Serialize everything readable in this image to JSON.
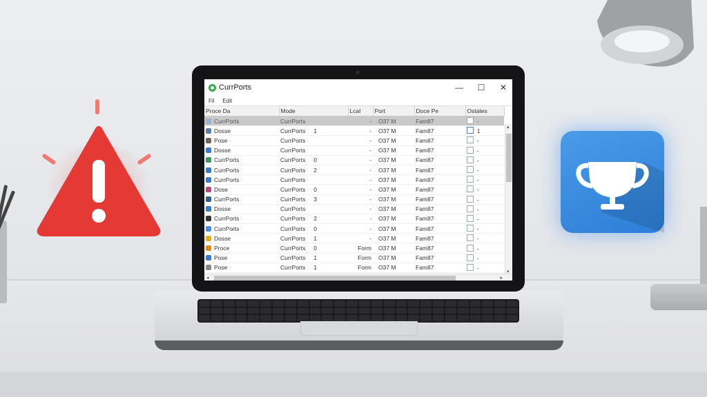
{
  "window": {
    "title": "CurrPorts",
    "minimize": "—",
    "maximize": "☐",
    "close": "✕"
  },
  "menu": [
    "Fil",
    "Edit"
  ],
  "table": {
    "columns": [
      "Proce Da",
      "Mode",
      "Lcal",
      "Port",
      "Doce Pe",
      "Ostates"
    ],
    "rows": [
      {
        "icon": "#9bb3cc",
        "name": "CurrPorts",
        "mode": "CurrPorts",
        "n": "",
        "lcal": "-",
        "port": "O37 M",
        "doce": "Fam87",
        "checked": false,
        "flag": "-"
      },
      {
        "icon": "#5f7fa8",
        "name": "Dosse",
        "mode": "CurrPorts",
        "n": "1",
        "lcal": "-",
        "port": "O37 M",
        "doce": "Fam87",
        "checked": true,
        "flag": "1"
      },
      {
        "icon": "#6e6658",
        "name": "Pose",
        "mode": "CurrPorts",
        "n": "",
        "lcal": "-",
        "port": "O37 M",
        "doce": "Fam87",
        "checked": false,
        "flag": "-"
      },
      {
        "icon": "#3b7bc8",
        "name": "Dosse",
        "mode": "CurrPorts",
        "n": "",
        "lcal": "-",
        "port": "O37 M",
        "doce": "Fam87",
        "checked": false,
        "flag": "-"
      },
      {
        "icon": "#3a9a5a",
        "name": "CurrPorts",
        "mode": "CurrPorts",
        "n": "0",
        "lcal": "-",
        "port": "O37 M",
        "doce": "Fam87",
        "checked": false,
        "flag": "-"
      },
      {
        "icon": "#3b7bc8",
        "name": "CurrPorts",
        "mode": "CurrPorts",
        "n": "2",
        "lcal": "-",
        "port": "O37 M",
        "doce": "Fam87",
        "checked": false,
        "flag": "-"
      },
      {
        "icon": "#3b7bc8",
        "name": "CurrPorts",
        "mode": "CurrPorts",
        "n": "",
        "lcal": "-",
        "port": "O37 M",
        "doce": "Fam87",
        "checked": false,
        "flag": "-"
      },
      {
        "icon": "#b04a7a",
        "name": "Dose",
        "mode": "CurrPorts",
        "n": "0",
        "lcal": "-",
        "port": "O37 M",
        "doce": "Fam87",
        "checked": false,
        "flag": "-"
      },
      {
        "icon": "#2f5f8f",
        "name": "CurrPorts",
        "mode": "CurrPorts",
        "n": "3",
        "lcal": "-",
        "port": "O37 M",
        "doce": "Fam87",
        "checked": false,
        "flag": "-"
      },
      {
        "icon": "#3b7bc8",
        "name": "Dosse",
        "mode": "CurrPorts",
        "n": "",
        "lcal": "-",
        "port": "O37 M",
        "doce": "Fam87",
        "checked": false,
        "flag": "-"
      },
      {
        "icon": "#333333",
        "name": "CurrPorts",
        "mode": "CurrPorts",
        "n": "2",
        "lcal": "-",
        "port": "O37 M",
        "doce": "Fam87",
        "checked": false,
        "flag": "-"
      },
      {
        "icon": "#4a8fd8",
        "name": "CurrPorts",
        "mode": "CurrPorts",
        "n": "0",
        "lcal": "-",
        "port": "O37 M",
        "doce": "Fam87",
        "checked": false,
        "flag": "-"
      },
      {
        "icon": "#e0b020",
        "name": "Dosse",
        "mode": "CurrPorts",
        "n": "1",
        "lcal": "-",
        "port": "O37 M",
        "doce": "Fam87",
        "checked": false,
        "flag": "-"
      },
      {
        "icon": "#e08a20",
        "name": "Proce",
        "mode": "CurrPorts",
        "n": "0",
        "lcal": "Form",
        "port": "O37 M",
        "doce": "Fam87",
        "checked": false,
        "flag": "-"
      },
      {
        "icon": "#3b7bc8",
        "name": "Pose",
        "mode": "CurrPorts",
        "n": "1",
        "lcal": "Form",
        "port": "O37 M",
        "doce": "Fam87",
        "checked": false,
        "flag": "-"
      },
      {
        "icon": "#888888",
        "name": "Pose",
        "mode": "CurrPorts",
        "n": "1",
        "lcal": "Form",
        "port": "O37 M",
        "doce": "Fam87",
        "checked": false,
        "flag": "-"
      },
      {
        "icon": "#aaaaaa",
        "name": "Proce",
        "mode": "CurrPorts",
        "n": "2",
        "lcal": "Form",
        "port": "O37 M",
        "doce": "Fam87",
        "checked": false,
        "flag": "-"
      }
    ],
    "selected_row": 0
  },
  "colors": {
    "warning_red": "#e53935",
    "trophy_blue": "#3a8ee6",
    "selection_gray": "#c9c9c9"
  },
  "icons": {
    "warning": "warning-triangle-icon",
    "trophy": "trophy-icon",
    "app": "currports-app-icon"
  }
}
